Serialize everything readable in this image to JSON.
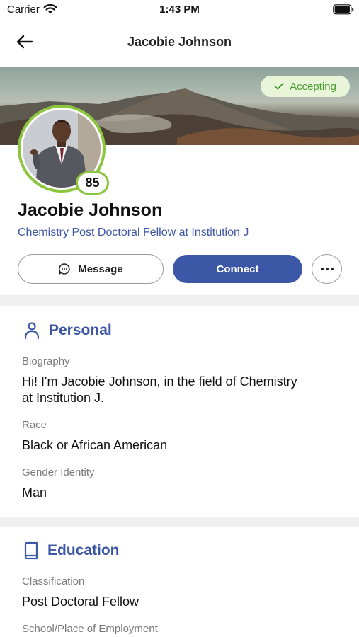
{
  "status_bar": {
    "carrier": "Carrier",
    "time": "1:43 PM"
  },
  "nav": {
    "title": "Jacobie Johnson"
  },
  "profile": {
    "status_label": "Accepting",
    "score": "85",
    "name": "Jacobie Johnson",
    "headline": "Chemistry Post Doctoral Fellow at Institution J"
  },
  "actions": {
    "message_label": "Message",
    "connect_label": "Connect"
  },
  "colors": {
    "accent": "#3b57a6",
    "ring": "#8cc63f",
    "pill_text": "#4a9b2e",
    "pill_bg": "#e8f5d9"
  },
  "personal": {
    "title": "Personal",
    "biography_label": "Biography",
    "biography_line1": "Hi!  I'm Jacobie Johnson, in the field of Chemistry",
    "biography_line2": "at Institution J.",
    "race_label": "Race",
    "race_value": "Black or African American",
    "gender_label": "Gender Identity",
    "gender_value": "Man"
  },
  "education": {
    "title": "Education",
    "classification_label": "Classification",
    "classification_value": "Post Doctoral Fellow",
    "school_label": "School/Place of Employment"
  }
}
